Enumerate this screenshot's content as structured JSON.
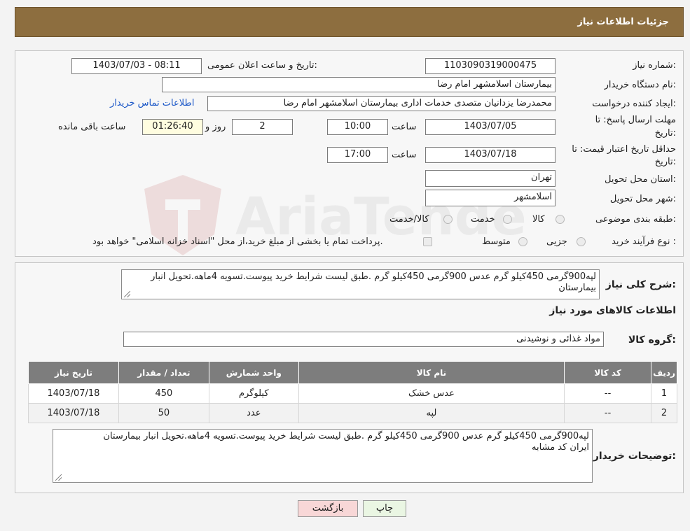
{
  "header": {
    "title": "جزئیات اطلاعات نیاز"
  },
  "watermark": {
    "text": "AriaTender.neT"
  },
  "form": {
    "need_number_label": "شماره نیاز:",
    "need_number": "1103090319000475",
    "announce_label": "تاریخ و ساعت اعلان عمومی:",
    "announce_value": "1403/07/03 - 08:11",
    "buyer_org_label": "نام دستگاه خریدار:",
    "buyer_org": "بیمارستان اسلامشهر   امام رضا",
    "creator_label": "ایجاد کننده درخواست:",
    "creator": "محمدرضا یزدانیان متصدی خدمات اداری بیمارستان اسلامشهر   امام رضا",
    "contact_link": "اطلاعات تماس خریدار",
    "deadline_label_1": "مهلت ارسال پاسخ: تا",
    "deadline_label_2": "تاریخ:",
    "deadline_date": "1403/07/05",
    "time_label": "ساعت",
    "deadline_time": "10:00",
    "days": "2",
    "days_label": "روز و",
    "remaining": "01:26:40",
    "remaining_label": "ساعت باقی مانده",
    "validity_label_1": "حداقل تاریخ اعتبار قیمت: تا",
    "validity_label_2": "تاریخ:",
    "validity_date": "1403/07/18",
    "validity_time": "17:00",
    "province_label": "استان محل تحویل:",
    "province": "تهران",
    "city_label": "شهر محل تحویل:",
    "city": "اسلامشهر",
    "category_label": "طبقه بندی موضوعی:",
    "category_options": [
      "کالا",
      "خدمت",
      "کالا/خدمت"
    ],
    "purchase_type_label": "نوع فرآیند خرید :",
    "purchase_options": [
      "جزیی",
      "متوسط"
    ],
    "purchase_note": "پرداخت تمام یا بخشی از مبلغ خرید،از محل \"اسناد خزانه اسلامی\" خواهد بود."
  },
  "summary": {
    "label": "شرح کلی نیاز:",
    "text": "لپه900گرمی 450کیلو گرم عدس 900گرمی 450کیلو گرم .طبق لیست شرایط خرید پیوست.تسویه 4ماهه.تحویل انبار بیمارستان",
    "goods_info_title": "اطلاعات کالاهای مورد نیاز",
    "group_label": "گروه کالا:",
    "group_value": "مواد غذائی و نوشیدنی"
  },
  "table": {
    "headers": [
      "ردیف",
      "کد کالا",
      "نام کالا",
      "واحد شمارش",
      "تعداد / مقدار",
      "تاریخ نیاز"
    ],
    "rows": [
      [
        "1",
        "--",
        "عدس خشک",
        "کیلوگرم",
        "450",
        "1403/07/18"
      ],
      [
        "2",
        "--",
        "لپه",
        "عدد",
        "50",
        "1403/07/18"
      ]
    ]
  },
  "buyer_notes": {
    "label": "توضیحات خریدار:",
    "line1": "لپه900گرمی 450کیلو گرم عدس 900گرمی 450کیلو گرم .طبق لیست شرایط خرید پیوست.تسویه 4ماهه.تحویل انبار بیمارستان",
    "line2": "ایران کد مشابه"
  },
  "buttons": {
    "print": "چاپ",
    "back": "بازگشت"
  },
  "colors": {
    "header": "#8d6e3f",
    "back_button": "#f8d7d7",
    "print_button": "#eaf6e3"
  }
}
